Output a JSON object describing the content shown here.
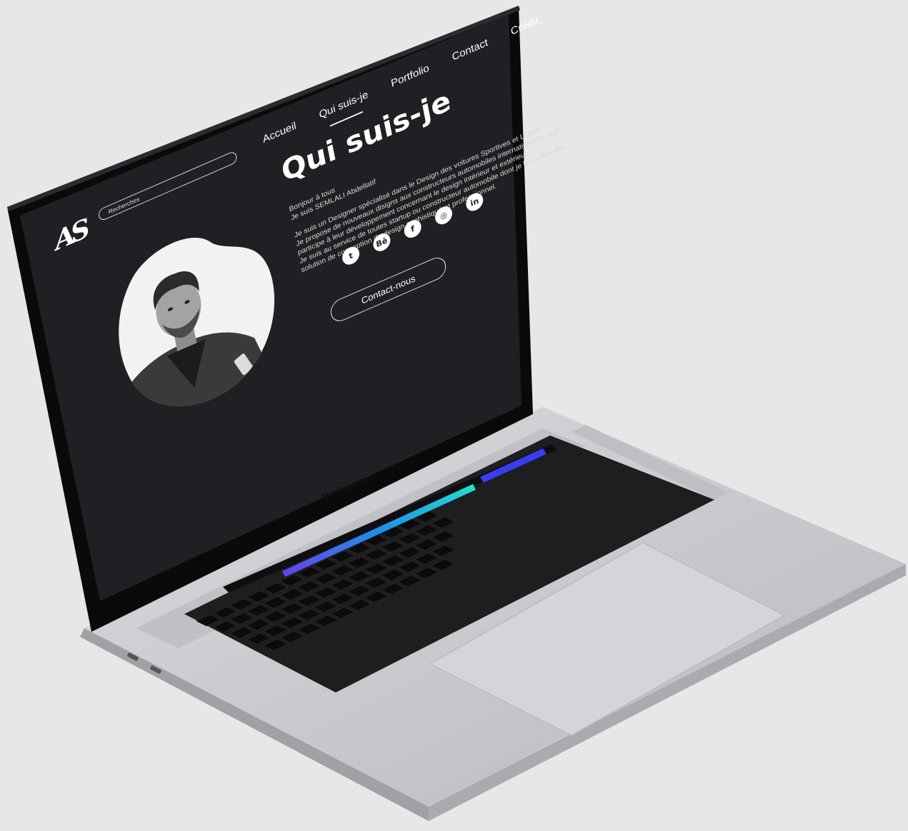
{
  "site": {
    "logo_text": "AS",
    "search": {
      "placeholder": "Recherches"
    },
    "nav": [
      {
        "label": "Accueil",
        "active": false
      },
      {
        "label": "Qui suis-je",
        "active": true
      },
      {
        "label": "Portfolio",
        "active": false
      },
      {
        "label": "Contact",
        "active": false
      },
      {
        "label": "Crédit",
        "active": false
      }
    ],
    "page_title": "Qui suis-je",
    "bio": {
      "p1": "Bonjour à tous\nJe suis SEMLALI Abdellatif",
      "p2": "Je suis un Designer spécialisé dans le Design des voitures Sportives et Luxes.\nJe propose de nouveaux disigns aux constructeurs automobiles internationaux, et je participe à leur développement concernant le design intérieur et extérieur.\nJe suis au service de toutes startup ou constructeur automobile dont je leur offre des solution de conception de design sophistiqué et professionnel."
    },
    "socials": [
      {
        "name": "twitter-icon",
        "glyph": "t"
      },
      {
        "name": "behance-icon",
        "glyph": "Bē"
      },
      {
        "name": "facebook-icon",
        "glyph": "f"
      },
      {
        "name": "instagram-icon",
        "glyph": "◎"
      },
      {
        "name": "linkedin-icon",
        "glyph": "in"
      }
    ],
    "cta_label": "Contact-nous"
  },
  "device": {
    "brand_label": "MacBook Pro",
    "colors": {
      "screen_bg": "#1f2023",
      "body": "#c9cbce",
      "background": "#e6e7e8",
      "touchbar_accent": "#2b7bd9"
    }
  }
}
